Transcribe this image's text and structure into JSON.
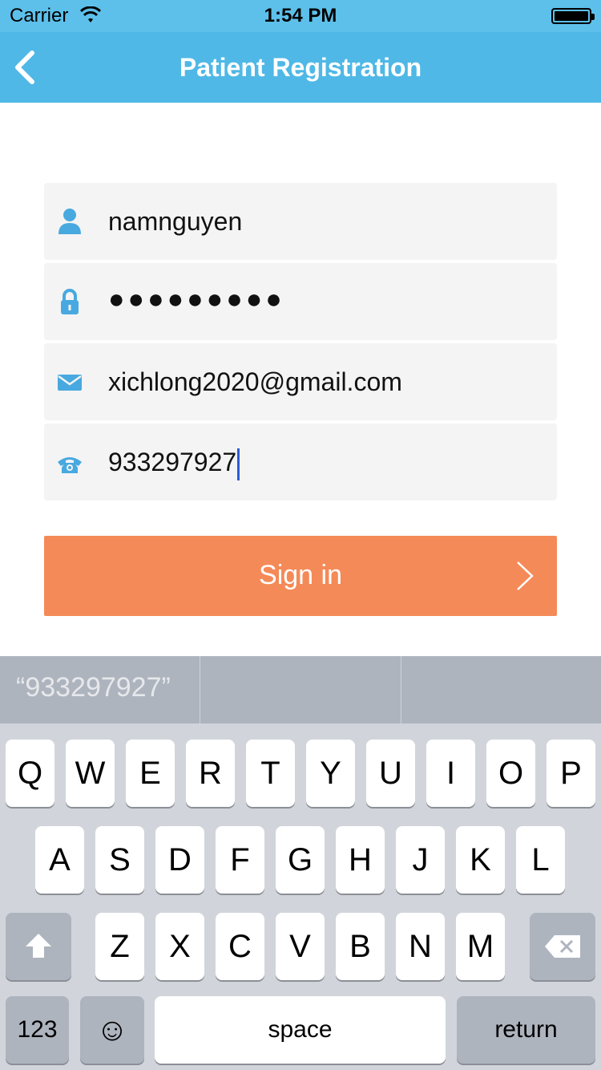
{
  "status_bar": {
    "carrier": "Carrier",
    "time": "1:54 PM"
  },
  "nav": {
    "title": "Patient Registration"
  },
  "form": {
    "username": "namnguyen",
    "password": "●●●●●●●●●",
    "email": "xichlong2020@gmail.com",
    "phone": "933297927"
  },
  "signin": {
    "label": "Sign in"
  },
  "keyboard": {
    "suggestion": "“933297927”",
    "row1": [
      "Q",
      "W",
      "E",
      "R",
      "T",
      "Y",
      "U",
      "I",
      "O",
      "P"
    ],
    "row2": [
      "A",
      "S",
      "D",
      "F",
      "G",
      "H",
      "J",
      "K",
      "L"
    ],
    "row3": [
      "Z",
      "X",
      "C",
      "V",
      "B",
      "N",
      "M"
    ],
    "numbers_label": "123",
    "emoji": "☺",
    "space_label": "space",
    "return_label": "return"
  },
  "colors": {
    "nav_bar": "#4fb8e6",
    "accent_icon": "#48a9e0",
    "sign_in_button": "#f48a58"
  }
}
